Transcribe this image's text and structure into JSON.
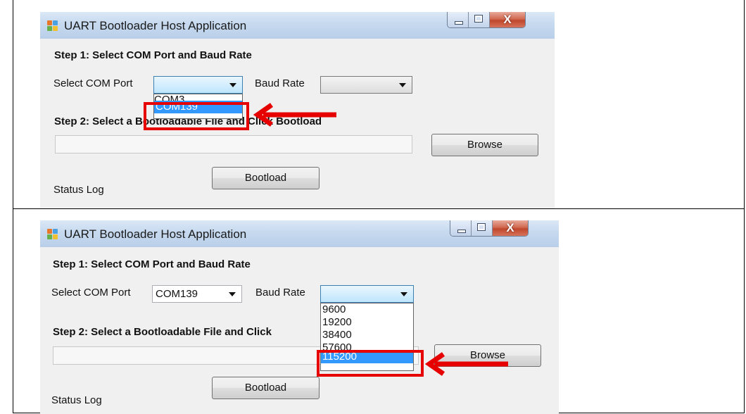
{
  "panel_top": {
    "window": {
      "title": "UART Bootloader Host Application",
      "close_glyph": "X"
    },
    "step1": "Step 1: Select COM Port and Baud Rate",
    "com_label": "Select COM Port",
    "baud_label": "Baud Rate",
    "com_value": "",
    "baud_value": "",
    "com_options": [
      "COM3",
      "COM139"
    ],
    "selected_option": "COM139",
    "step2": "Step 2: Select a Bootloadable File and Click Bootload",
    "browse": "Browse",
    "bootload": "Bootload",
    "status_log": "Status Log"
  },
  "panel_bottom": {
    "window": {
      "title": "UART Bootloader Host Application",
      "close_glyph": "X"
    },
    "step1": "Step 1: Select COM Port and Baud Rate",
    "com_label": "Select COM Port",
    "baud_label": "Baud Rate",
    "com_value": "COM139",
    "baud_value": "",
    "baud_options": [
      "9600",
      "19200",
      "38400",
      "57600",
      "115200"
    ],
    "selected_option": "115200",
    "step2": "Step 2: Select a Bootloadable File and Click",
    "browse": "Browse",
    "bootload": "Bootload",
    "status_log": "Status Log"
  },
  "colors": {
    "highlight": "#e60000",
    "selection": "#3399ff"
  }
}
